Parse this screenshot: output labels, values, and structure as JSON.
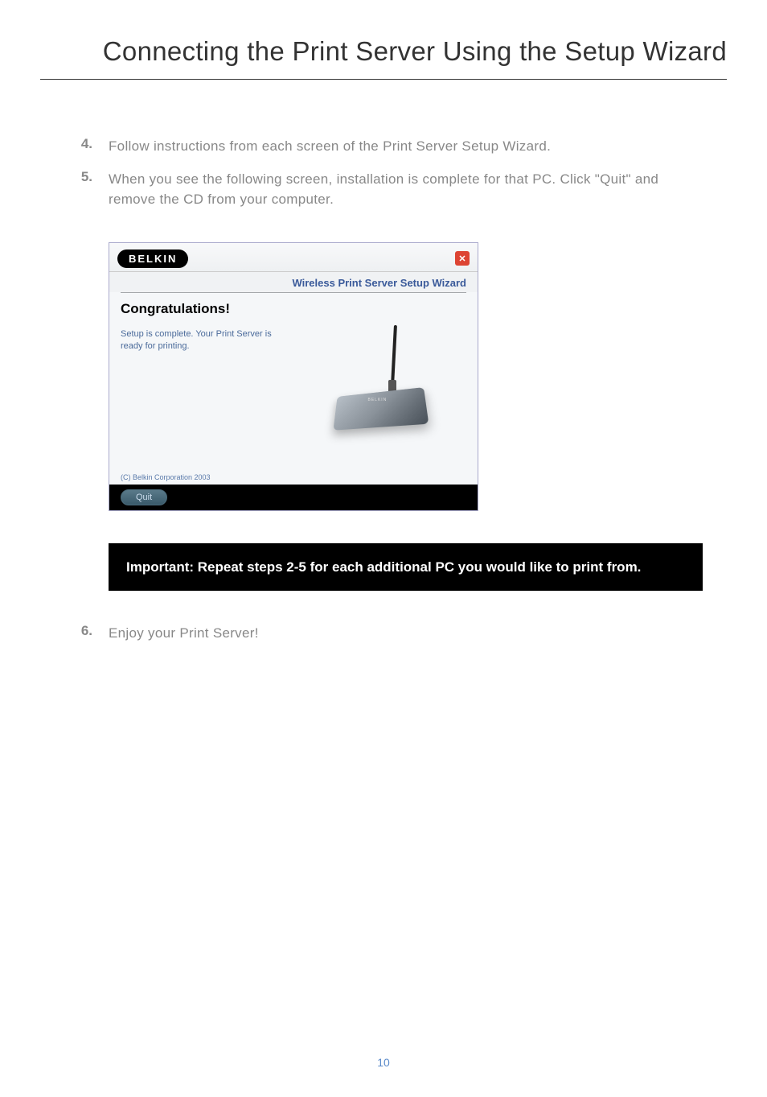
{
  "page_title": "Connecting the Print Server Using the Setup Wizard",
  "steps": [
    {
      "num": "4.",
      "text": "Follow instructions from each screen of the Print Server Setup Wizard."
    },
    {
      "num": "5.",
      "text": "When you see the following screen, installation is complete for that PC. Click \"Quit\" and remove the CD from your computer."
    },
    {
      "num": "6.",
      "text": "Enjoy your Print Server!"
    }
  ],
  "wizard": {
    "logo": "BELKIN",
    "close": "✕",
    "subtitle": "Wireless Print Server Setup Wizard",
    "congrats": "Congratulations!",
    "setup_msg": "Setup is complete. Your Print Server is ready for printing.",
    "device_label": "BELKIN",
    "copyright": "(C) Belkin Corporation 2003",
    "quit": "Quit"
  },
  "important": {
    "bold": "Important: Repeat steps 2-5 for each additional PC you would like to print from."
  },
  "page_number": "10"
}
